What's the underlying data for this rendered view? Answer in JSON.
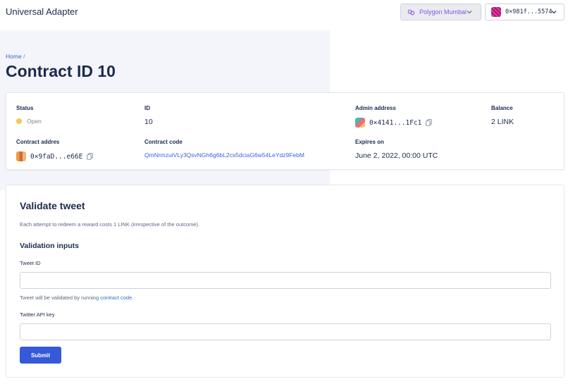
{
  "header": {
    "app_title": "Universal Adapter",
    "network_label": "Polygon Mumbai",
    "wallet_address": "0×981f...5574"
  },
  "breadcrumb": {
    "home": "Home",
    "separator": "/"
  },
  "page": {
    "title": "Contract ID 10"
  },
  "details": {
    "status": {
      "label": "Status",
      "value": "Open",
      "color": "#f7c94a"
    },
    "id": {
      "label": "ID",
      "value": "10"
    },
    "admin_address": {
      "label": "Admin address",
      "value": "0×4141...1Fc1"
    },
    "balance": {
      "label": "Balance",
      "value": "2 LINK"
    },
    "contract_address": {
      "label": "Contract addres",
      "value": "0×9faD...e66E"
    },
    "contract_code": {
      "label": "Contract code",
      "value": "QmNrmzuiVLy3QsvNGh6g6bL2cs5dciaG6w54LeYdz9FebM"
    },
    "expires_on": {
      "label": "Expires on",
      "value": "June 2, 2022, 00:00 UTC"
    }
  },
  "validate": {
    "title": "Validate tweet",
    "description": "Each attempt to redeem a reward costs 1 LINK (irrespective of the outcome).",
    "subtitle": "Validation inputs",
    "tweet_id": {
      "label": "Tweet ID",
      "value": "",
      "placeholder": ""
    },
    "hint_prefix": "Tweet will be validated by running",
    "hint_link": "contract code",
    "hint_suffix": ".",
    "api_key": {
      "label": "Twitter API key",
      "value": "",
      "placeholder": ""
    },
    "submit_label": "Submit"
  },
  "colors": {
    "accent": "#3559d9",
    "link": "#3c63d9",
    "network_text": "#8a57d6"
  }
}
